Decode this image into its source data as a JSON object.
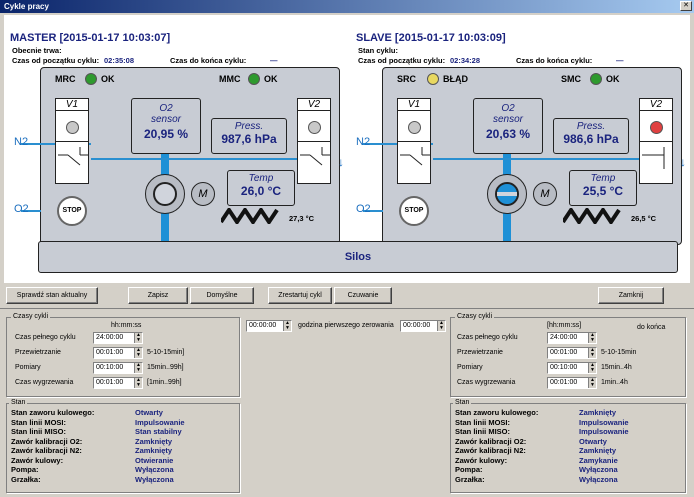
{
  "window": {
    "title": "Cykle pracy"
  },
  "master": {
    "title": "MASTER",
    "timestamp": "[2015-01-17 10:03:07]",
    "line1_label": "Obecnie trwa:",
    "line1_value": "",
    "elapsed_label": "Czas od początku cyklu:",
    "elapsed_value": "02:35:08",
    "remaining_label": "Czas do końca cyklu:",
    "remaining_value": "—",
    "left_status_label": "MRC",
    "left_status_text": "OK",
    "left_status_color": "#2e9a2e",
    "right_status_label": "MMC",
    "right_status_text": "OK",
    "right_status_color": "#2e9a2e",
    "v1_label": "V1",
    "v1_led": "#c8c8c8",
    "v2_label": "V2",
    "v2_led": "#c8c8c8",
    "o2_title": "O2",
    "o2_sub": "sensor",
    "o2_value": "20,95 %",
    "press_title": "Press.",
    "press_value": "987,6 hPa",
    "temp_title": "Temp",
    "temp_value": "26,0 °C",
    "heater_temp": "27,3 °C",
    "pump_label": "M",
    "stop_label": "STOP",
    "n2_label": "N2",
    "o2_in_label": "O2"
  },
  "slave": {
    "title": "SLAVE",
    "timestamp": "[2015-01-17 10:03:09]",
    "line1_label": "Stan cyklu:",
    "line1_value": "",
    "elapsed_label": "Czas od początku cyklu:",
    "elapsed_value": "02:34:28",
    "remaining_label": "Czas do końca cyklu:",
    "remaining_value": "—",
    "left_status_label": "SRC",
    "left_status_text": "BŁĄD",
    "left_status_color": "#e8d860",
    "right_status_label": "SMC",
    "right_status_text": "OK",
    "right_status_color": "#2e9a2e",
    "v1_label": "V1",
    "v1_led": "#c8c8c8",
    "v2_label": "V2",
    "v2_led": "#e04040",
    "o2_title": "O2",
    "o2_sub": "sensor",
    "o2_value": "20,63 %",
    "press_title": "Press.",
    "press_value": "986,6 hPa",
    "temp_title": "Temp",
    "temp_value": "25,5 °C",
    "heater_temp": "26,5 °C",
    "pump_label": "M",
    "stop_label": "STOP",
    "n2_label": "N2",
    "o2_in_label": "O2"
  },
  "silos_label": "Silos",
  "buttons": {
    "check": "Sprawdź stan aktualny",
    "save": "Zapisz",
    "defaults": "Domyślne",
    "restart": "Zrestartuj cykl",
    "standby": "Czuwanie",
    "close": "Zamknij"
  },
  "cycles_left": {
    "title": "Czasy cykli",
    "unit_header": "hh:mm:ss",
    "rows": [
      {
        "label": "Czas pełnego cyklu",
        "value": "24:00:00",
        "hint": ""
      },
      {
        "label": "Przewietrzanie",
        "value": "00:01:00",
        "hint": "5-10-15min]"
      },
      {
        "label": "Pomiary",
        "value": "00:10:00",
        "hint": "15min..99h]"
      },
      {
        "label": "Czas wygrzewania",
        "value": "00:01:00",
        "hint": "[1min..99h]"
      }
    ]
  },
  "middle": {
    "first_value": "00:00:00",
    "zero_label": "godzina pierwszego zerowania",
    "zero_value": "00:00:00"
  },
  "cycles_right": {
    "title": "Czasy cykli",
    "unit_header": "[hh:mm:ss]",
    "end_label": "do końca",
    "rows": [
      {
        "label": "Czas pełnego cyklu",
        "value": "24:00:00",
        "hint": ""
      },
      {
        "label": "Przewietrzanie",
        "value": "00:01:00",
        "hint": "5-10-15min"
      },
      {
        "label": "Pomiary",
        "value": "00:10:00",
        "hint": "15min..4h"
      },
      {
        "label": "Czas wygrzewania",
        "value": "00:01:00",
        "hint": "1min..4h"
      }
    ]
  },
  "state_left": {
    "title": "Stan",
    "rows": [
      {
        "label": "Stan zaworu kulowego:",
        "value": "Otwarty"
      },
      {
        "label": "Stan linii MOSI:",
        "value": "Impulsowanie"
      },
      {
        "label": "Stan linii MISO:",
        "value": "Stan stabilny"
      },
      {
        "label": "Zawór kalibracji O2:",
        "value": "Zamknięty"
      },
      {
        "label": "Zawór kalibracji N2:",
        "value": "Zamknięty"
      },
      {
        "label": "Zawór kulowy:",
        "value": "Otwieranie"
      },
      {
        "label": "Pompa:",
        "value": "Wyłączona"
      },
      {
        "label": "Grzałka:",
        "value": "Wyłączona"
      }
    ]
  },
  "state_right": {
    "title": "Stan",
    "rows": [
      {
        "label": "Stan zaworu kulowego:",
        "value": "Zamknięty"
      },
      {
        "label": "Stan linii MOSI:",
        "value": "Impulsowanie"
      },
      {
        "label": "Stan linii MISO:",
        "value": "Impulsowanie"
      },
      {
        "label": "Zawór kalibracji O2:",
        "value": "Otwarty"
      },
      {
        "label": "Zawór kalibracji N2:",
        "value": "Zamknięty"
      },
      {
        "label": "Zawór kulowy:",
        "value": "Zamykanie"
      },
      {
        "label": "Pompa:",
        "value": "Wyłączona"
      },
      {
        "label": "Grzałka:",
        "value": "Wyłączona"
      }
    ]
  }
}
